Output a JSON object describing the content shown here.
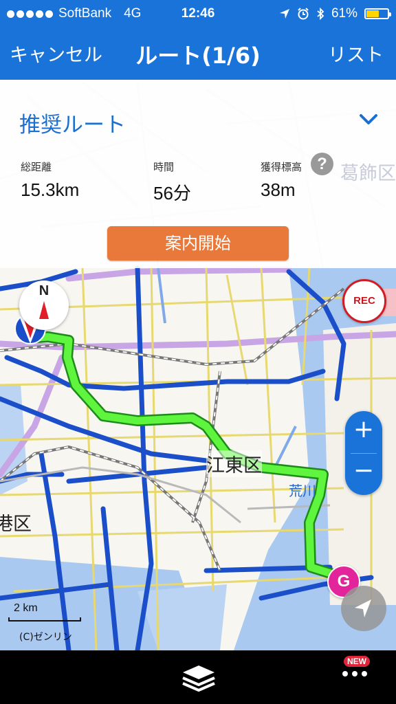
{
  "status_bar": {
    "carrier": "SoftBank",
    "network": "4G",
    "time": "12:46",
    "battery_percent": "61%",
    "battery_level": 0.61,
    "icons": [
      "signal-dots",
      "location-arrow-icon",
      "alarm-icon",
      "bluetooth-icon",
      "battery-icon"
    ]
  },
  "nav": {
    "cancel_label": "キャンセル",
    "title": "ルート(1/6)",
    "list_label": "リスト"
  },
  "route": {
    "name": "推奨ルート",
    "expand_icon": "chevron-down-icon",
    "stats": {
      "distance_label": "総距離",
      "distance_value": "15.3km",
      "time_label": "時間",
      "time_value": "56分",
      "elevation_label": "獲得標高",
      "elevation_value": "38m",
      "help_label": "?"
    },
    "start_button_label": "案内開始"
  },
  "map": {
    "compass_label": "N",
    "rec_label": "REC",
    "zoom_in_label": "+",
    "zoom_out_label": "−",
    "scale_label": "2 km",
    "copyright": "(C)ゼンリン",
    "labels": {
      "koto": "江東区",
      "arakawa": "荒川",
      "minato_partial": "港区",
      "katsushika_partial": "葛飾区"
    },
    "goal_marker": "G",
    "colors": {
      "route": "#44e63a",
      "water": "#a9c9f0",
      "major_road": "#1a4fc9",
      "accent": "#1a73d9"
    }
  },
  "bottom_bar": {
    "layers_icon": "layers-icon",
    "more_icon": "more-dots-icon",
    "new_badge": "NEW"
  }
}
